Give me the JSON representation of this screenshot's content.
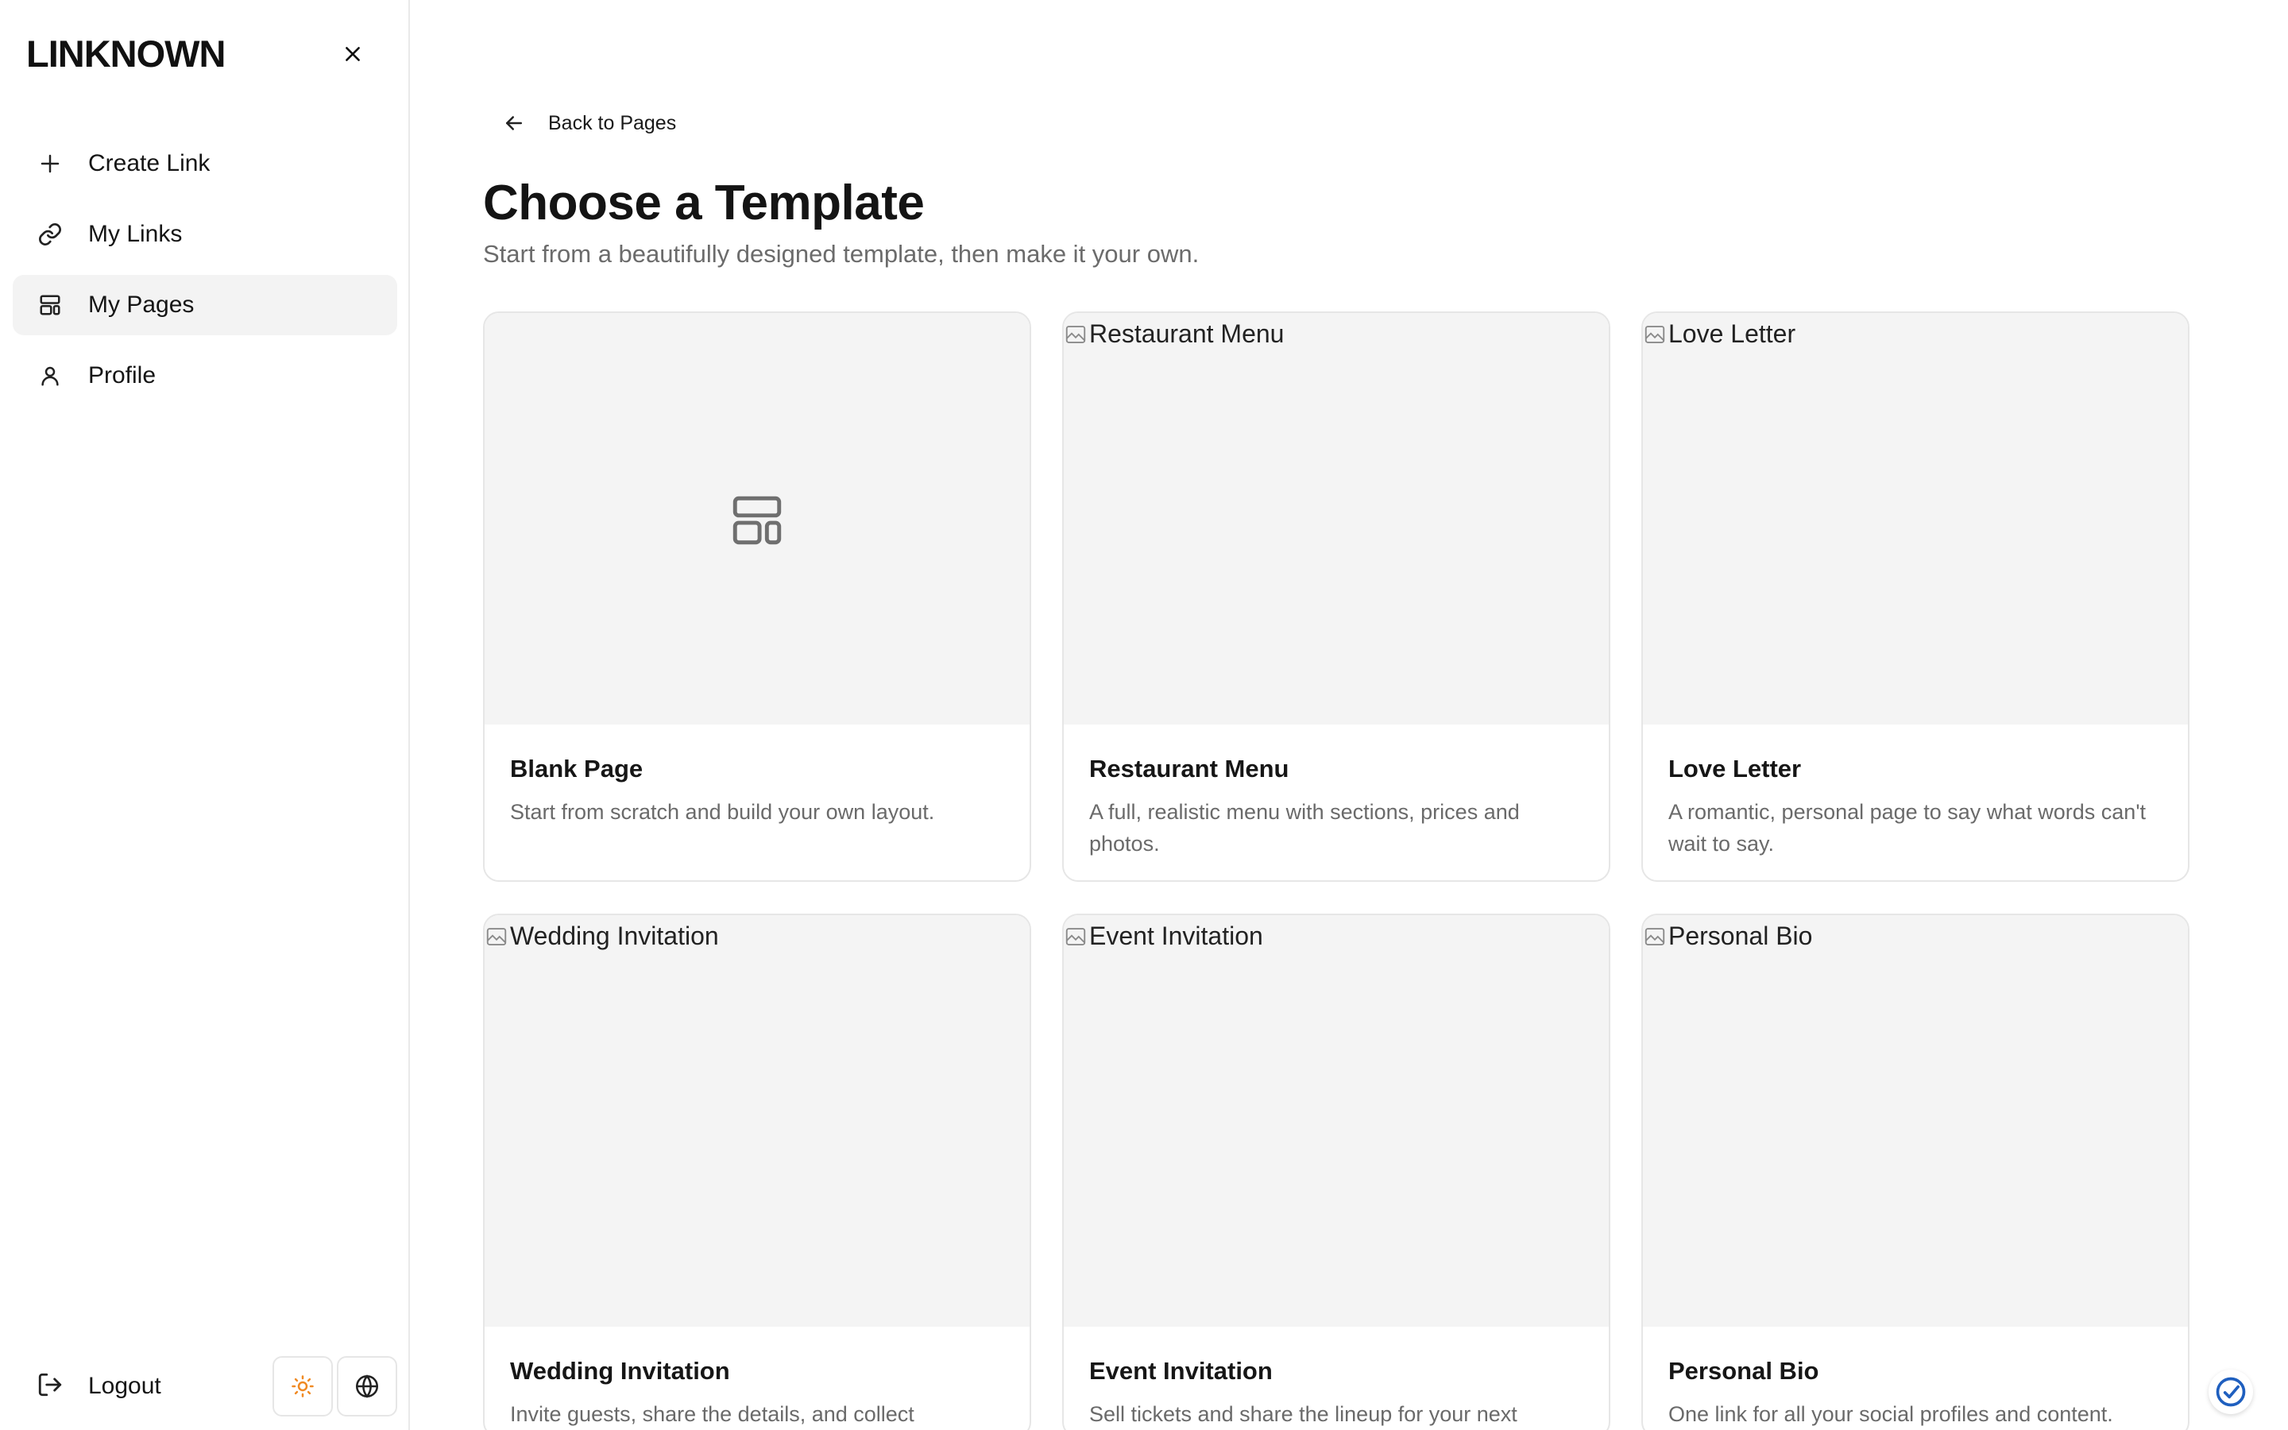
{
  "app": {
    "brand": "LINKNOWN"
  },
  "sidebar": {
    "items": [
      {
        "label": "Create Link",
        "icon": "plus-icon",
        "active": false
      },
      {
        "label": "My Links",
        "icon": "link-icon",
        "active": false
      },
      {
        "label": "My Pages",
        "icon": "layout-icon",
        "active": true
      },
      {
        "label": "Profile",
        "icon": "user-icon",
        "active": false
      }
    ],
    "logout_label": "Logout",
    "accent_color": "#f08a24"
  },
  "main": {
    "back_label": "Back to Pages",
    "title": "Choose a Template",
    "subtitle": "Start from a beautifully designed template, then make it your own.",
    "templates": [
      {
        "title": "Blank Page",
        "description": "Start from scratch and build your own layout.",
        "image_alt": ""
      },
      {
        "title": "Restaurant Menu",
        "description": "A full, realistic menu with sections, prices and photos.",
        "image_alt": "Restaurant Menu"
      },
      {
        "title": "Love Letter",
        "description": "A romantic, personal page to say what words can't wait to say.",
        "image_alt": "Love Letter"
      },
      {
        "title": "Wedding Invitation",
        "description": "Invite guests, share the details, and collect",
        "image_alt": "Wedding Invitation"
      },
      {
        "title": "Event Invitation",
        "description": "Sell tickets and share the lineup for your next",
        "image_alt": "Event Invitation"
      },
      {
        "title": "Personal Bio",
        "description": "One link for all your social profiles and content.",
        "image_alt": "Personal Bio"
      }
    ]
  }
}
